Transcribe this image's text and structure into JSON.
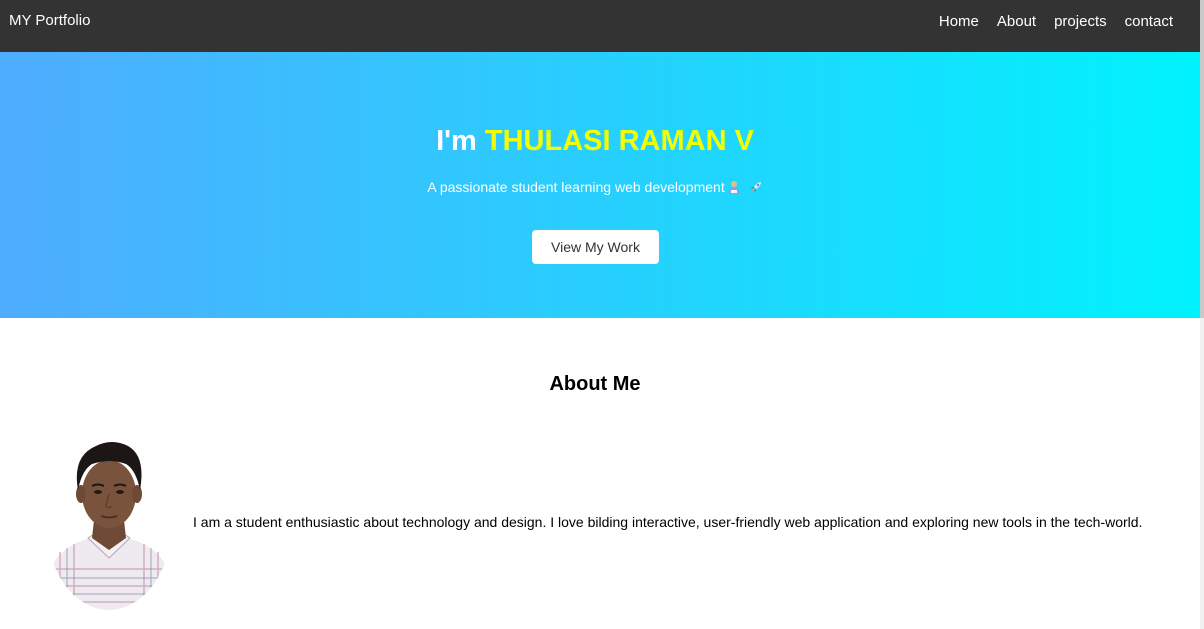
{
  "nav": {
    "brand": "MY Portfolio",
    "links": [
      {
        "label": "Home"
      },
      {
        "label": "About"
      },
      {
        "label": "projects"
      },
      {
        "label": "contact"
      }
    ]
  },
  "hero": {
    "greeting": "I'm",
    "name": "THULASI RAMAN V",
    "subtitle": "A passionate student learning web development",
    "button_label": "View My Work"
  },
  "about": {
    "title": "About Me",
    "text": "I am a student enthusiastic about technology and design. I love bilding interactive, user-friendly web application and exploring new tools in the tech-world."
  },
  "colors": {
    "navbar": "#333333",
    "hero_gradient_start": "#4facfe",
    "hero_gradient_end": "#00f2fe",
    "name_highlight": "#f2ff00"
  },
  "icons": [
    "student-emoji-icon",
    "rocket-emoji-icon"
  ]
}
